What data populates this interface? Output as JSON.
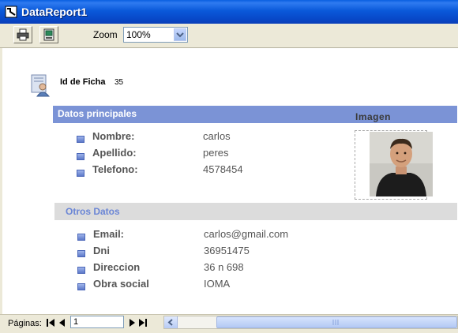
{
  "window": {
    "title": "DataReport1"
  },
  "toolbar": {
    "print_icon": "printer-icon",
    "export_icon": "export-icon",
    "zoom_label": "Zoom",
    "zoom_value": "100%"
  },
  "report": {
    "id_label": "Id de Ficha",
    "id_value": "35",
    "section_main": {
      "title": "Datos principales",
      "image_title": "Imagen",
      "fields": [
        {
          "label": "Nombre:",
          "value": "carlos"
        },
        {
          "label": "Apellido:",
          "value": "peres"
        },
        {
          "label": "Telefono:",
          "value": "4578454"
        }
      ]
    },
    "section_other": {
      "title": "Otros Datos",
      "fields": [
        {
          "label": "Email:",
          "value": "carlos@gmail.com"
        },
        {
          "label": "Dni",
          "value": "36951475"
        },
        {
          "label": "Direccion",
          "value": "36 n 698"
        },
        {
          "label": "Obra social",
          "value": "IOMA"
        }
      ]
    }
  },
  "status": {
    "pages_label": "Páginas:",
    "page_value": "1"
  },
  "colors": {
    "title_bar": "#0A59DA",
    "section_band": "#7B93D6",
    "section_other_band": "#DCDCDC",
    "section_other_text": "#6B86D6"
  }
}
